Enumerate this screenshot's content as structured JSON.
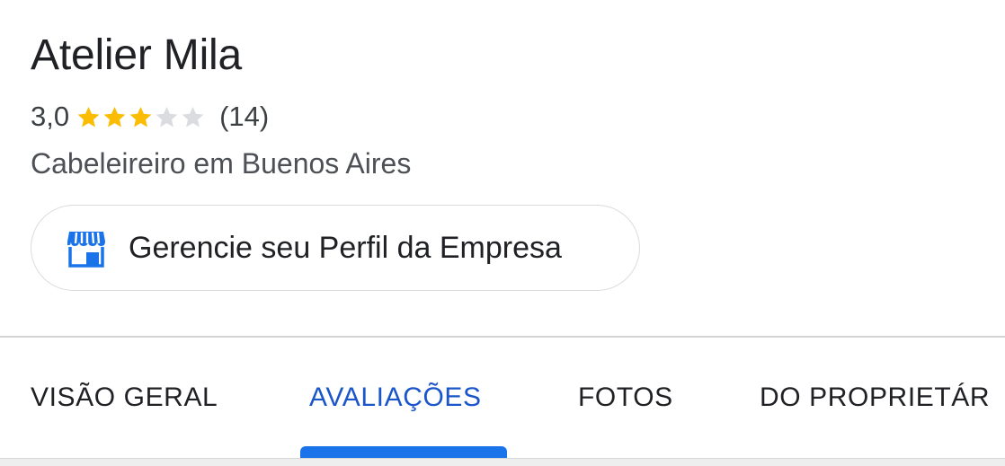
{
  "business": {
    "name": "Atelier Mila",
    "rating": "3,0",
    "rating_value": 3,
    "rating_max": 5,
    "review_count": "(14)",
    "category": "Cabeleireiro em Buenos Aires"
  },
  "manage_profile": {
    "label": "Gerencie seu Perfil da Empresa",
    "icon": "storefront-icon"
  },
  "tabs": [
    {
      "label": "VISÃO GERAL",
      "active": false
    },
    {
      "label": "AVALIAÇÕES",
      "active": true
    },
    {
      "label": "FOTOS",
      "active": false
    },
    {
      "label": "DO PROPRIETÁR",
      "active": false
    }
  ],
  "colors": {
    "star_filled": "#fbbc04",
    "star_empty": "#dadce0",
    "active_tab": "#1a56c9",
    "tab_indicator": "#1a73e8",
    "icon_blue": "#1a73e8"
  }
}
